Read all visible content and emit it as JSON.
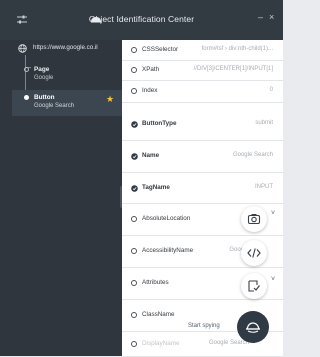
{
  "window": {
    "title": "Object Identification Center",
    "minimize_glyph": "–",
    "close_glyph": "×"
  },
  "tree": {
    "root": {
      "label": "https://www.google.co.il"
    },
    "page": {
      "label": "Page",
      "sub": "Google"
    },
    "button": {
      "label": "Button",
      "sub": "Google Search"
    }
  },
  "properties": [
    {
      "label": "CSSSelector",
      "value": "form#tsf › div:nth-child(1)...",
      "checked": false
    },
    {
      "label": "XPath",
      "value": "//DIV[3]/CENTER[1]/INPUT[1]",
      "checked": false
    },
    {
      "label": "Index",
      "value": "0",
      "checked": false
    },
    {
      "label": "ButtonType",
      "value": "submit",
      "checked": true
    },
    {
      "label": "Name",
      "value": "Google Search",
      "checked": true
    },
    {
      "label": "TagName",
      "value": "INPUT",
      "checked": true
    },
    {
      "label": "AbsoluteLocation",
      "value": "",
      "checked": false
    },
    {
      "label": "AccessibilityName",
      "value": "Goog...",
      "checked": false
    },
    {
      "label": "Attributes",
      "value": "",
      "checked": false
    },
    {
      "label": "ClassName",
      "value": "",
      "checked": false
    },
    {
      "label": "DisplayName",
      "value": "Google Search",
      "checked": false
    }
  ],
  "actions": {
    "start_spying_label": "Start spying"
  },
  "colors": {
    "titlebar": "#323a42",
    "left_panel": "#2f363d",
    "selected_row": "#3c4650",
    "star": "#f2c433",
    "check_fill": "#2f3a44"
  },
  "icons": [
    "settings-icon",
    "logo-icon",
    "minimize-icon",
    "close-icon",
    "globe-icon",
    "star-icon",
    "camera-icon",
    "code-icon",
    "export-icon",
    "spy-icon",
    "chevron-down-icon"
  ]
}
